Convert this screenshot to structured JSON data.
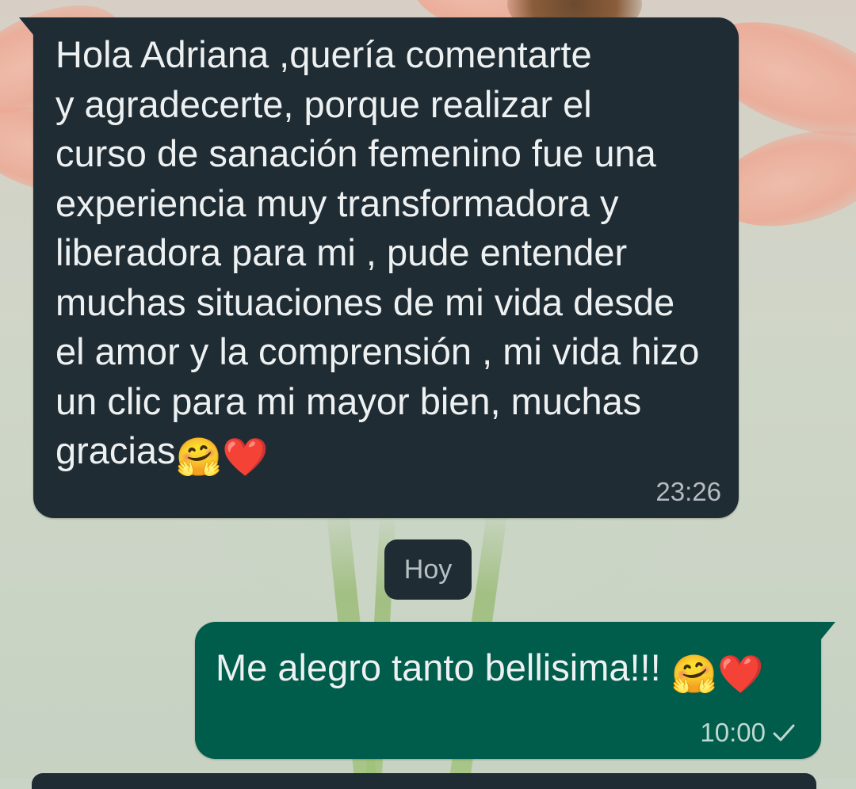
{
  "chat": {
    "incoming": {
      "text": "Hola Adriana ,quería comentarte\ny agradecerte, porque  realizar el\ncurso de sanación femenino fue una\nexperiencia muy transformadora y\nliberadora para mi , pude entender\nmuchas situaciones de mi vida desde\nel amor y la comprensión , mi vida hizo\nun clic para mi mayor bien, muchas\ngracias",
      "emojis": [
        "🤗",
        "❤️"
      ],
      "time": "23:26"
    },
    "date_divider": "Hoy",
    "outgoing": {
      "text": "Me alegro tanto bellisima!!! ",
      "emojis": [
        "🤗",
        "❤️"
      ],
      "time": "10:00",
      "status_icon": "single-check-icon"
    }
  },
  "colors": {
    "incoming_bubble": "#202c33",
    "outgoing_bubble": "#005c4b",
    "text": "#e9edef"
  }
}
